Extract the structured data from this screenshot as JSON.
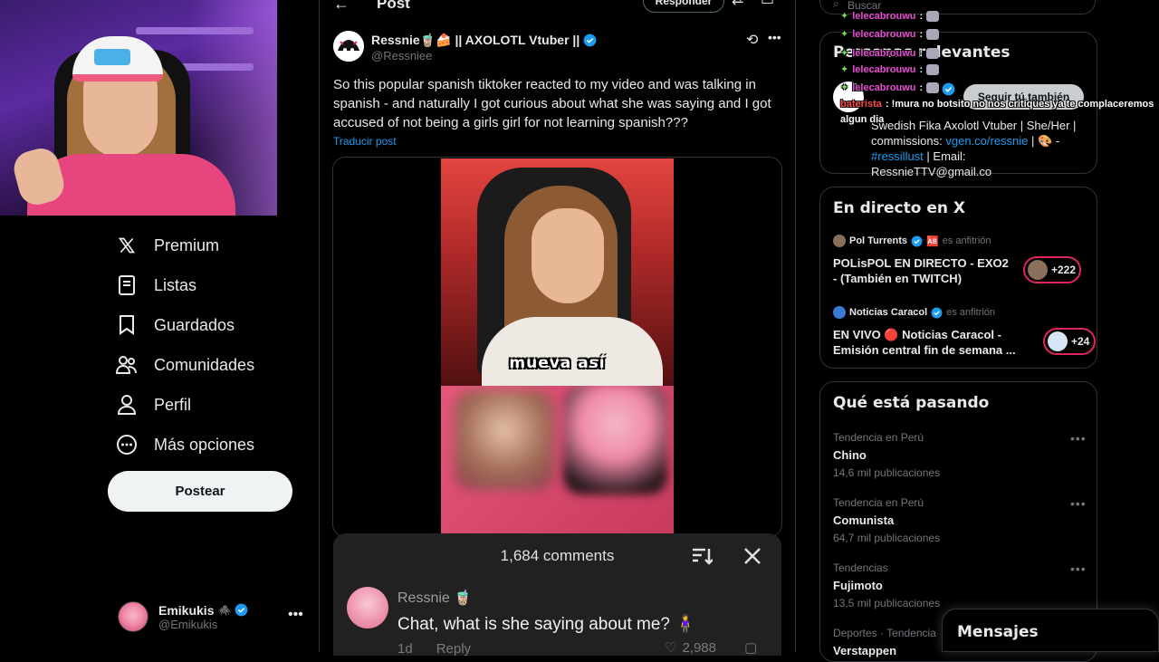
{
  "nav": {
    "items": [
      {
        "label": "Premium",
        "icon": "x-logo-icon"
      },
      {
        "label": "Listas",
        "icon": "list-icon"
      },
      {
        "label": "Guardados",
        "icon": "bookmark-icon"
      },
      {
        "label": "Comunidades",
        "icon": "communities-icon"
      },
      {
        "label": "Perfil",
        "icon": "person-icon"
      },
      {
        "label": "Más opciones",
        "icon": "more-circle-icon"
      }
    ],
    "post_button": "Postear",
    "account": {
      "name": "Emikukis",
      "emoji": "🕷️",
      "handle": "@Emikukis"
    }
  },
  "header": {
    "title": "Post",
    "reply_button": "Responder"
  },
  "post": {
    "author_name": "Ressnie🧋🍰 || AXOLOTL Vtuber ||",
    "handle": "@Ressniee",
    "text": "So this popular spanish tiktoker reacted to my video and was talking in spanish - and naturally I got curious about what she was saying and I got accused of not being a girls girl for not learning spanish???",
    "translate": "Traducir post",
    "video_caption": "mueva así"
  },
  "comments_sheet": {
    "title": "1,684 comments",
    "comment": {
      "author": "Ressnie 🧋",
      "text": "Chat, what is she saying about me? 🧍‍♀️",
      "age": "1d",
      "reply": "Reply",
      "likes": "2,988"
    }
  },
  "search": {
    "placeholder": "Buscar"
  },
  "relevant_people": {
    "title": "Personas relevantes",
    "follow_button": "Seguir tú también",
    "bio_prefix": "Swedish Fika Axolotl Vtuber | She/Her | commissions: ",
    "bio_link": "vgen.co/ressnie",
    "bio_mid": " | 🎨 - ",
    "bio_hashtag": "#ressillust",
    "bio_suffix": " | Email: RessnieTTV@gmail.co"
  },
  "live": {
    "title": "En directo en X",
    "rows": [
      {
        "host": "Pol Turrents",
        "emoji": "🆎",
        "role": "es anfitrión",
        "title": "POLisPOL EN DIRECTO - EXO2 - (También en TWITCH)",
        "count": "+222"
      },
      {
        "host": "Noticias Caracol",
        "emoji": "",
        "role": "es anfitrión",
        "title": "EN VIVO 🔴 Noticias Caracol - Emisión central fin de semana ...",
        "count": "+24"
      }
    ]
  },
  "trends": {
    "title": "Qué está pasando",
    "items": [
      {
        "context": "Tendencia en Perú",
        "name": "Chino",
        "posts": "14,6 mil publicaciones"
      },
      {
        "context": "Tendencia en Perú",
        "name": "Comunista",
        "posts": "64,7 mil publicaciones"
      },
      {
        "context": "Tendencias",
        "name": "Fujimoto",
        "posts": "13,5 mil publicaciones"
      },
      {
        "context": "Deportes · Tendencia",
        "name": "Verstappen",
        "posts": ""
      }
    ]
  },
  "chat": {
    "lines": [
      {
        "user": "lelecabrouwu",
        "msg": ":"
      },
      {
        "user": "lelecabrouwu",
        "msg": ":"
      },
      {
        "user": "lelecabrouwu",
        "msg": ":"
      },
      {
        "user": "lelecabrouwu",
        "msg": ":"
      },
      {
        "user": "lelecabrouwu",
        "msg": ":"
      },
      {
        "user": "lelecabrouwu",
        "msg": ":"
      }
    ],
    "last_user": "baterista",
    "last_msg": ": !mura no botsito no nos critiques ya te complaceremos",
    "last_msg_cont": "algun dia"
  },
  "messages": {
    "label": "Mensajes"
  },
  "colors": {
    "accent": "#1d9bf0",
    "live": "#e0245e",
    "background": "#000000"
  }
}
